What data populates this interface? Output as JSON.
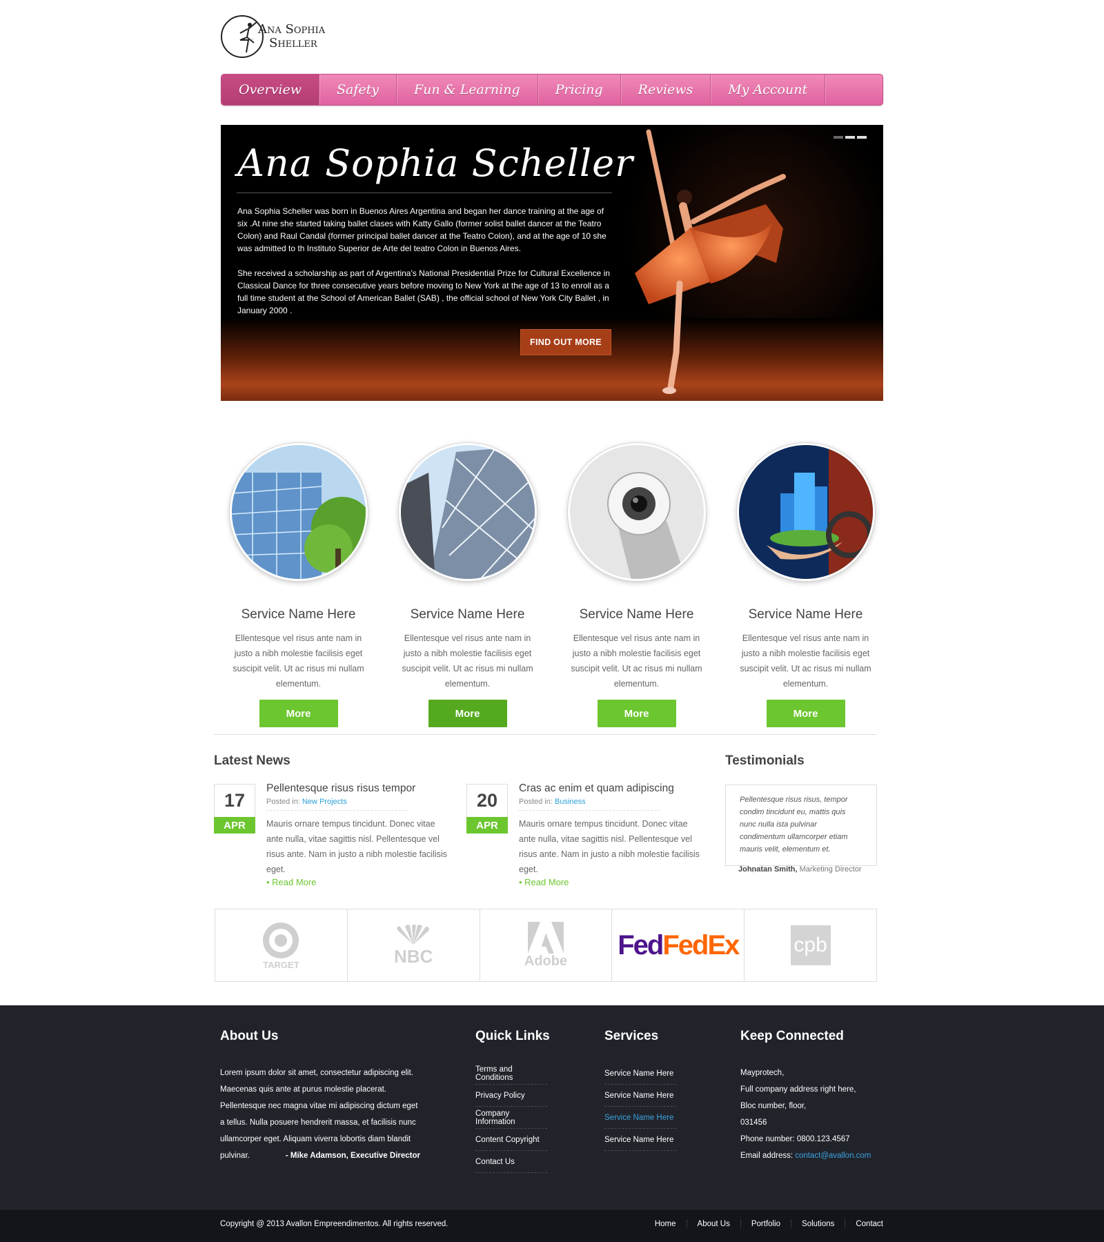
{
  "brand": {
    "line1": "Ana Sophia",
    "line2": "Sheller"
  },
  "nav": [
    {
      "label": "Overview",
      "active": true
    },
    {
      "label": "Safety"
    },
    {
      "label": "Fun & Learning"
    },
    {
      "label": "Pricing"
    },
    {
      "label": "Reviews"
    },
    {
      "label": "My Account"
    }
  ],
  "hero": {
    "title": "Ana Sophia Scheller",
    "p1": "Ana Sophia Scheller was born in Buenos Aires Argentina and began her dance training at the age of six .At nine she started taking ballet clases with Katty Gallo (former solist ballet dancer at the Teatro Colon) and Raul Candal (former principal ballet dancer at the Teatro Colon), and at the age of 10 she was admitted to th Instituto Superior de Arte del teatro Colon in Buenos Aires.",
    "p2": "She received a scholarship as part of Argentina's National Presidential Prize for Cultural Excellence in Classical Dance for three consecutive years before moving to New York at the age of 13 to enroll as a full time student at the School of American Ballet (SAB) , the official school of New York City Ballet , in January 2000 .",
    "button": "FIND OUT MORE"
  },
  "services": [
    {
      "title": "Service Name Here",
      "text": "Ellentesque vel risus ante nam in justo a nibh molestie facilisis eget suscipit velit. Ut ac risus mi nullam elementum.",
      "button": "More"
    },
    {
      "title": "Service Name Here",
      "text": "Ellentesque vel risus ante nam in justo a nibh molestie facilisis eget suscipit velit. Ut ac risus mi nullam elementum.",
      "button": "More"
    },
    {
      "title": "Service Name Here",
      "text": "Ellentesque vel risus ante nam in justo a nibh molestie facilisis eget suscipit velit. Ut ac risus mi nullam elementum.",
      "button": "More"
    },
    {
      "title": "Service Name Here",
      "text": "Ellentesque vel risus ante nam in justo a nibh molestie facilisis eget suscipit velit. Ut ac risus mi nullam elementum.",
      "button": "More"
    }
  ],
  "news": {
    "heading": "Latest News",
    "posted_in": "Posted in:",
    "items": [
      {
        "day": "17",
        "month": "APR",
        "title": "Pellentesque risus risus tempor",
        "category": "New Projects",
        "text": "Mauris ornare tempus tincidunt. Donec vitae ante nulla, vitae sagittis nisl. Pellentesque vel risus ante. Nam in justo a nibh molestie facilisis eget.",
        "more": "• Read More"
      },
      {
        "day": "20",
        "month": "APR",
        "title": "Cras ac enim et quam adipiscing",
        "category": "Business",
        "text": "Mauris ornare tempus tincidunt. Donec vitae ante nulla, vitae sagittis nisl. Pellentesque vel risus ante. Nam in justo a nibh molestie facilisis eget.",
        "more": "• Read More"
      }
    ]
  },
  "testimonials": {
    "heading": "Testimonials",
    "quote": "Pellentesque risus risus, tempor condim tincidunt eu, mattis quis nunc nulla ista pulvinar condimentum ullamcorper etiam mauris velit, elementum et.",
    "author": "Johnatan Smith,",
    "role": "Marketing Director"
  },
  "clients": [
    "TARGET",
    "NBC",
    "Adobe",
    "FedEx",
    "cpb"
  ],
  "footer": {
    "about": {
      "heading": "About Us",
      "text": "Lorem ipsum dolor sit amet, consectetur adipiscing elit. Maecenas quis ante at purus molestie placerat. Pellentesque nec magna vitae mi adipiscing dictum eget a tellus. Nulla posuere hendrerit massa, et facilisis nunc ullamcorper eget. Aliquam viverra lobortis diam blandit pulvinar.",
      "sign": "- Mike Adamson, Executive Director"
    },
    "quick_links": {
      "heading": "Quick Links",
      "items": [
        "Terms and Conditions",
        "Privacy Policy",
        "Company Information",
        "Content Copyright",
        "Contact Us"
      ]
    },
    "services": {
      "heading": "Services",
      "items": [
        "Service Name Here",
        "Service Name Here",
        "Service Name Here",
        "Service Name Here"
      ]
    },
    "connect": {
      "heading": "Keep Connected",
      "company": "Mayprotech,",
      "address1": "Full company address right here,",
      "address2": "Bloc number, floor,",
      "zip": "031456",
      "phone": "Phone number: 0800.123.4567",
      "email_label": "Email address:",
      "email": "contact@avallon.com"
    }
  },
  "bottom": {
    "copyright": "Copyright @ 2013 Avallon Empreendimentos. All rights reserved.",
    "links": [
      "Home",
      "About Us",
      "Portfolio",
      "Solutions",
      "Contact"
    ]
  },
  "colors": {
    "nav_pink": "#e570a8",
    "accent_green": "#6cc62f",
    "hero_button": "#a63e17",
    "link_blue": "#2a9fd8",
    "footer_bg": "#20222a"
  }
}
